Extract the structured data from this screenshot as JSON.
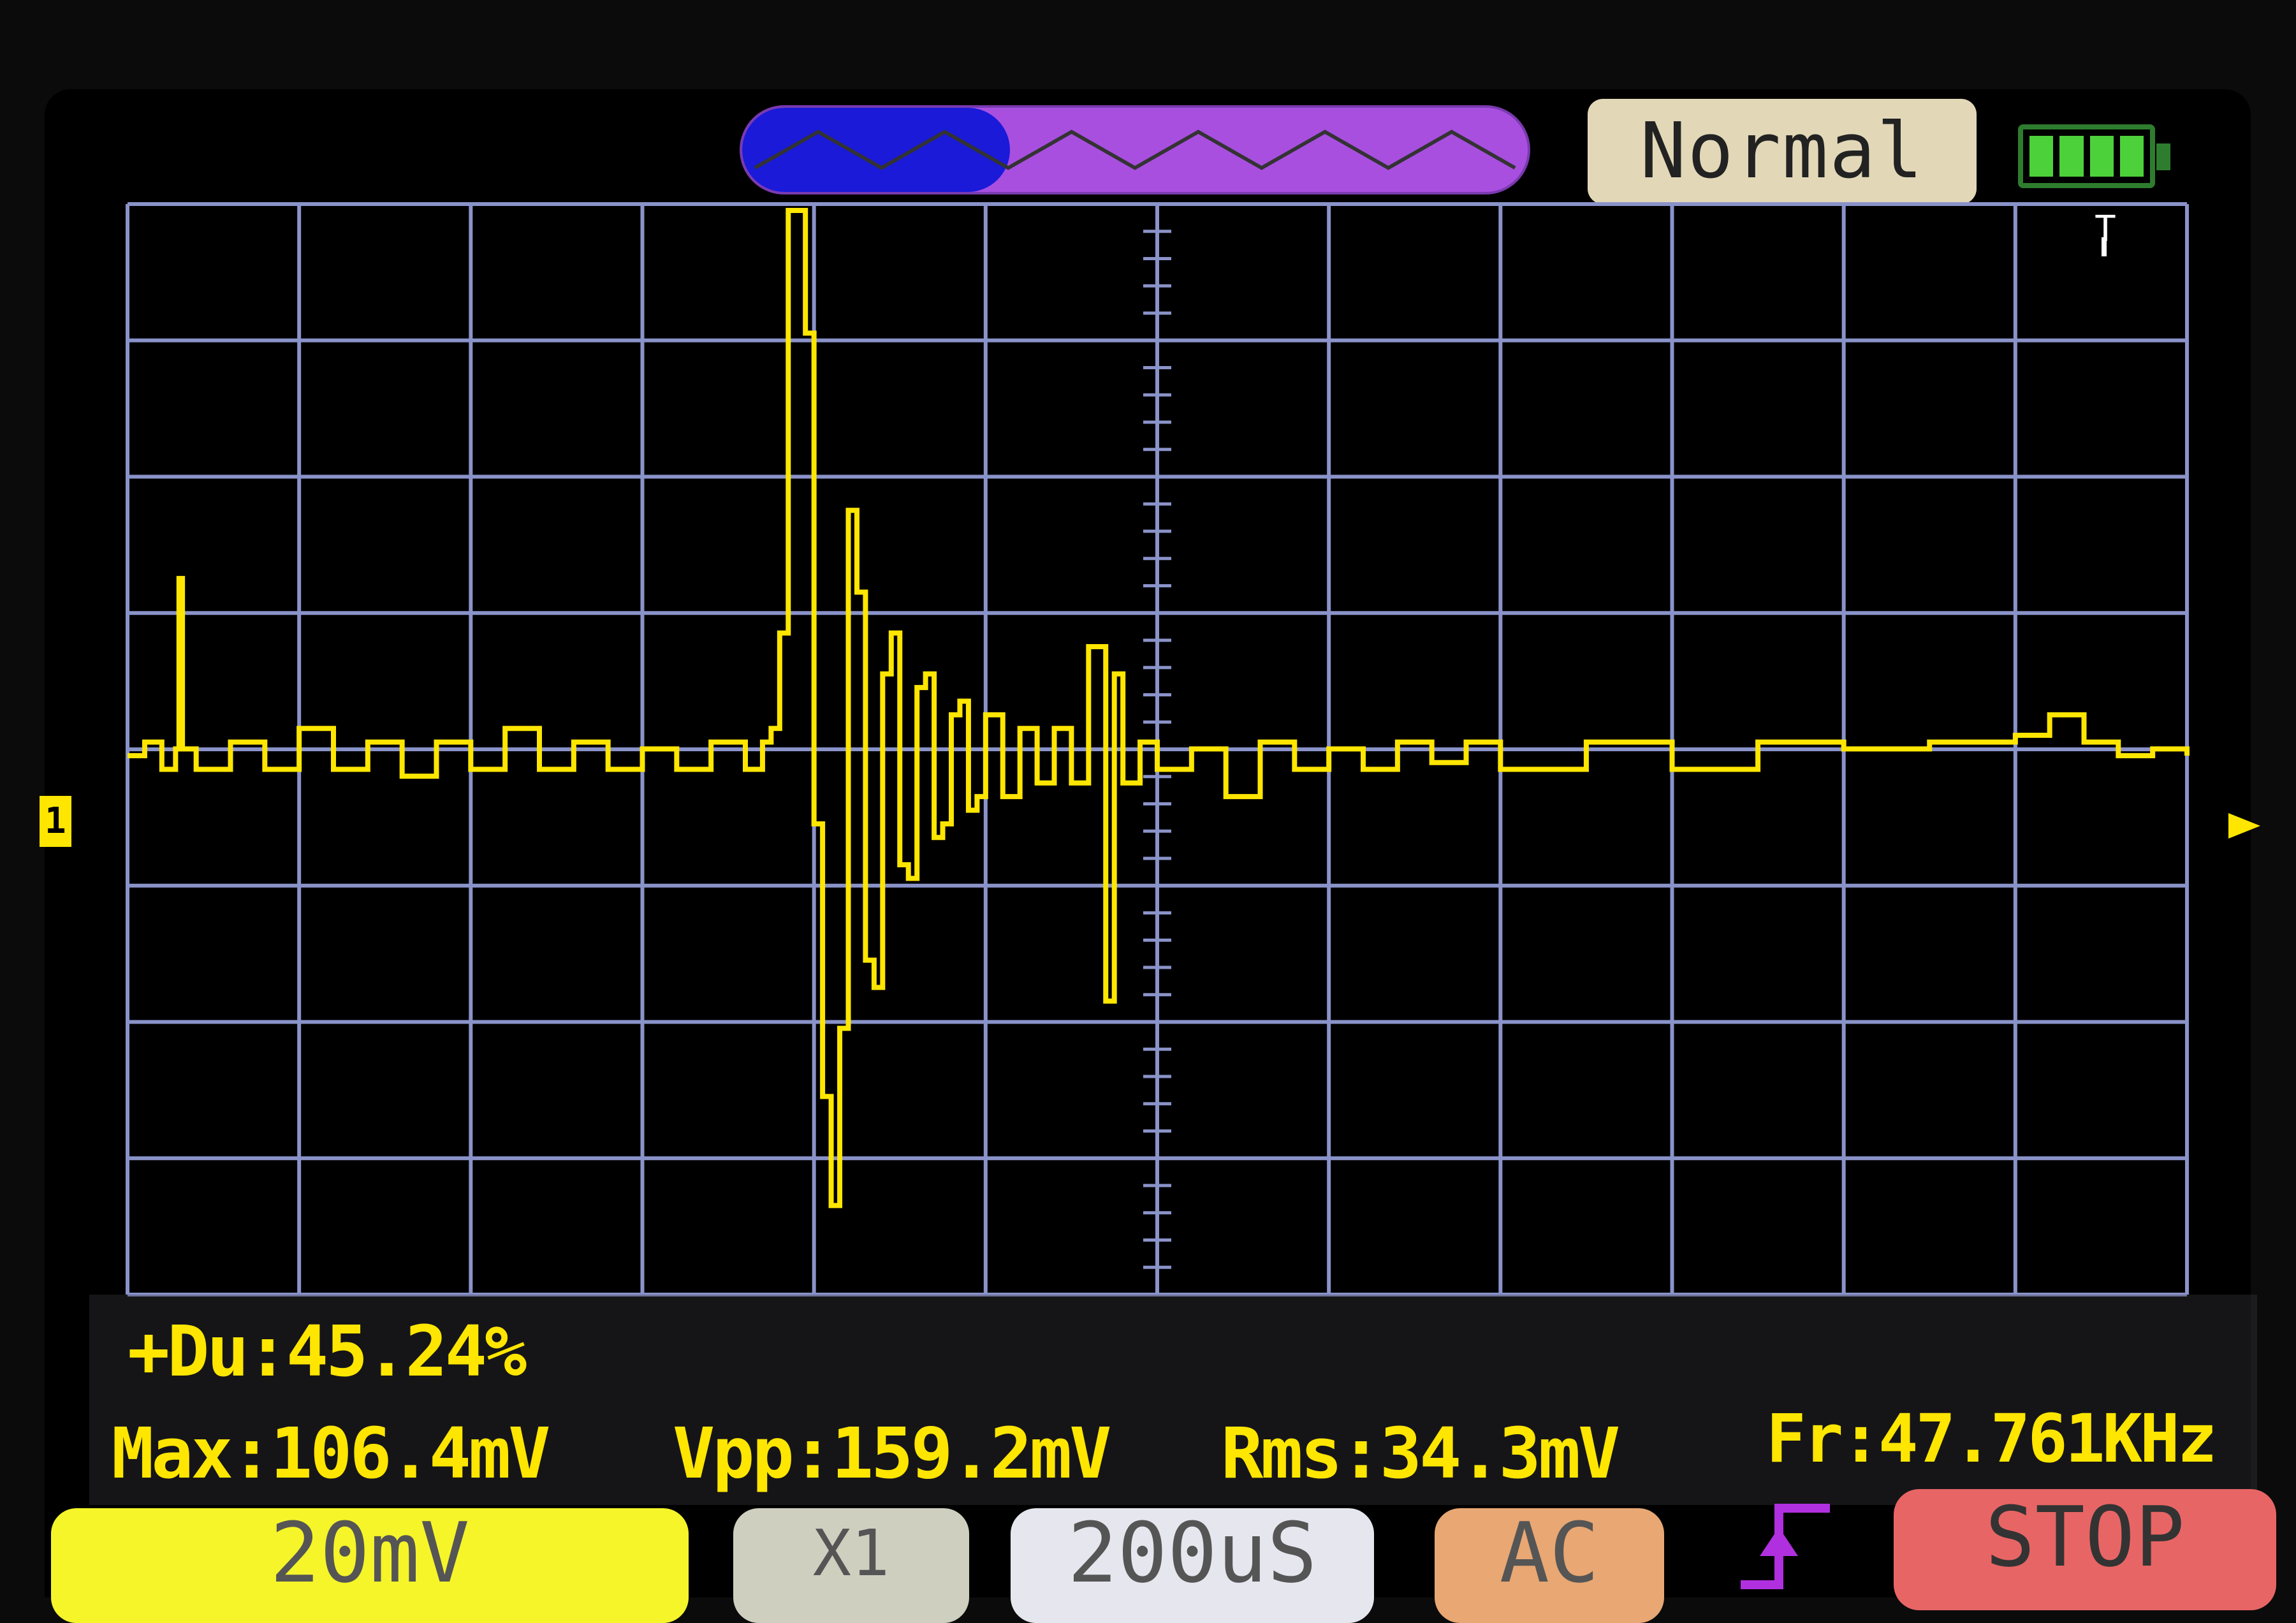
{
  "top_bar": {
    "trigger_mode": "Normal",
    "battery_icon": "battery-full-icon",
    "memory_icon": "waveform-memory-icon"
  },
  "channel": {
    "marker": "1",
    "color": "#ffe600"
  },
  "trigger": {
    "marker_icon": "trigger-position-icon",
    "marker_glyph": "T"
  },
  "measurements": {
    "duty": "+Du:45.24%",
    "max": "Max:106.4mV",
    "vpp": "Vpp:159.2mV",
    "rms": "Rms:34.3mV",
    "freq": "Fr:47.761KHz"
  },
  "controls": {
    "volts_div": "20mV",
    "probe": "X1",
    "time_div": "200uS",
    "coupling": "AC",
    "edge_icon": "rising-edge-icon",
    "run_state": "STOP"
  },
  "colors": {
    "trace": "#ffe600",
    "grid": "#8a93c9",
    "volts_button": "#f5f52a",
    "coupling_button": "#e8a773",
    "stop_button": "#e86565",
    "memory_bar": "#a84fe0",
    "memory_view": "#1a1ad8"
  },
  "chart_data": {
    "type": "line",
    "x_divisions": 12,
    "y_divisions": 8,
    "x_unit_per_div": "200uS",
    "y_unit_per_div": "20mV",
    "grid": true,
    "series": [
      {
        "x": [
          0,
          0.1,
          0.2,
          0.28,
          0.3,
          0.32,
          0.4,
          0.6,
          0.8,
          1.0,
          1.2,
          1.4,
          1.6,
          1.8,
          2.0,
          2.2,
          2.4,
          2.6,
          2.8,
          3.0,
          3.2,
          3.4,
          3.6,
          3.7,
          3.75,
          3.8,
          3.85,
          3.9,
          3.95,
          4.0,
          4.05,
          4.1,
          4.15,
          4.2,
          4.25,
          4.3,
          4.35,
          4.4,
          4.45,
          4.5,
          4.55,
          4.6,
          4.65,
          4.7,
          4.75,
          4.8,
          4.85,
          4.9,
          4.95,
          5.0,
          5.1,
          5.2,
          5.3,
          5.4,
          5.5,
          5.6,
          5.7,
          5.75,
          5.8,
          5.9,
          6.0,
          6.2,
          6.4,
          6.6,
          6.8,
          7.0,
          7.2,
          7.4,
          7.6,
          7.8,
          8.0,
          8.5,
          9.0,
          9.5,
          10.0,
          10.5,
          11.0,
          11.2,
          11.4,
          11.6,
          11.8,
          12.0
        ],
        "y": [
          0,
          0.1,
          -0.1,
          0.05,
          1.3,
          0.05,
          -0.1,
          0.1,
          -0.1,
          0.2,
          -0.1,
          0.1,
          -0.15,
          0.1,
          -0.1,
          0.2,
          -0.1,
          0.1,
          -0.1,
          0.05,
          -0.1,
          0.1,
          -0.1,
          0.1,
          0.2,
          0.9,
          4.0,
          4.0,
          3.1,
          -0.5,
          -2.5,
          -3.3,
          -2.0,
          1.8,
          1.2,
          -1.5,
          -1.7,
          0.6,
          0.9,
          -0.8,
          -0.9,
          0.5,
          0.6,
          -0.6,
          -0.5,
          0.3,
          0.4,
          -0.4,
          -0.3,
          0.3,
          -0.3,
          0.2,
          -0.2,
          0.2,
          -0.2,
          0.8,
          -1.8,
          0.6,
          -0.2,
          0.1,
          -0.1,
          0.05,
          -0.3,
          0.1,
          -0.1,
          0.05,
          -0.1,
          0.1,
          -0.05,
          0.1,
          -0.1,
          0.1,
          -0.1,
          0.1,
          0.05,
          0.1,
          0.15,
          0.3,
          0.1,
          0.0,
          0.05,
          0.0
        ]
      }
    ]
  }
}
